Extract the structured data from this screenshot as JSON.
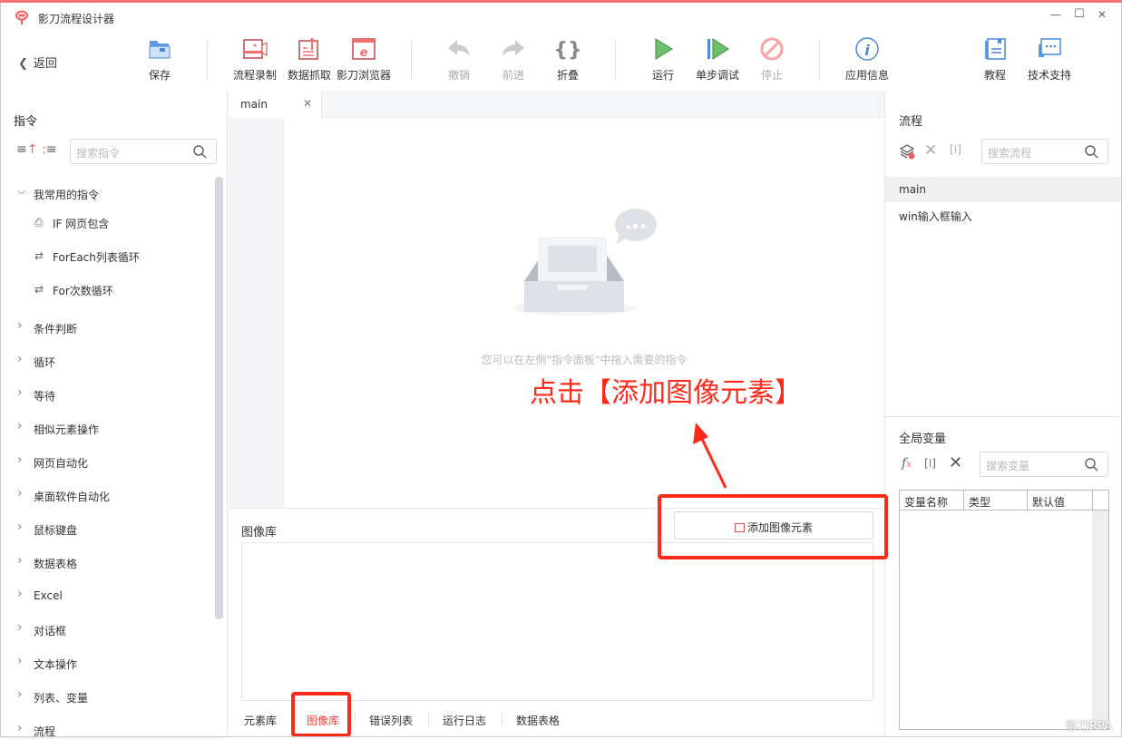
{
  "window": {
    "title": "影刀流程设计器",
    "min": "—",
    "max": "☐",
    "close": "✕"
  },
  "toolbar": {
    "back": "返回",
    "save": "保存",
    "record": "流程录制",
    "capture": "数据抓取",
    "browser": "影刀浏览器",
    "undo": "撤销",
    "redo": "前进",
    "fold": "折叠",
    "run": "运行",
    "step": "单步调试",
    "stop": "停止",
    "app_info": "应用信息",
    "tutorial": "教程",
    "support": "技术支持"
  },
  "left": {
    "title": "指令",
    "search_placeholder": "搜索指令",
    "items": [
      {
        "label": "我常用的指令",
        "expanded": true
      },
      {
        "label": "IF 网页包含",
        "child": true
      },
      {
        "label": "ForEach列表循环",
        "child": true
      },
      {
        "label": "For次数循环",
        "child": true
      },
      {
        "label": "条件判断"
      },
      {
        "label": "循环"
      },
      {
        "label": "等待"
      },
      {
        "label": "相似元素操作"
      },
      {
        "label": "网页自动化"
      },
      {
        "label": "桌面软件自动化"
      },
      {
        "label": "鼠标键盘"
      },
      {
        "label": "数据表格"
      },
      {
        "label": "Excel"
      },
      {
        "label": "对话框"
      },
      {
        "label": "文本操作"
      },
      {
        "label": "列表、变量"
      },
      {
        "label": "流程"
      }
    ]
  },
  "editor": {
    "tab": "main",
    "empty_hint": "您可以在左侧\"指令面板\"中拖入需要的指令"
  },
  "bottom": {
    "title": "图像库",
    "add_button": "添加图像元素",
    "tabs": [
      "元素库",
      "图像库",
      "错误列表",
      "运行日志",
      "数据表格"
    ],
    "active_tab": 1
  },
  "right": {
    "flow_title": "流程",
    "flow_search": "搜索流程",
    "flows": [
      "main",
      "win输入框输入"
    ],
    "var_title": "全局变量",
    "var_search": "搜索变量",
    "var_columns": [
      "变量名称",
      "类型",
      "默认值"
    ]
  },
  "annotation": {
    "text": "点击【添加图像元素】",
    "color": "#ff2a1a"
  },
  "watermark": "影刀RPA"
}
